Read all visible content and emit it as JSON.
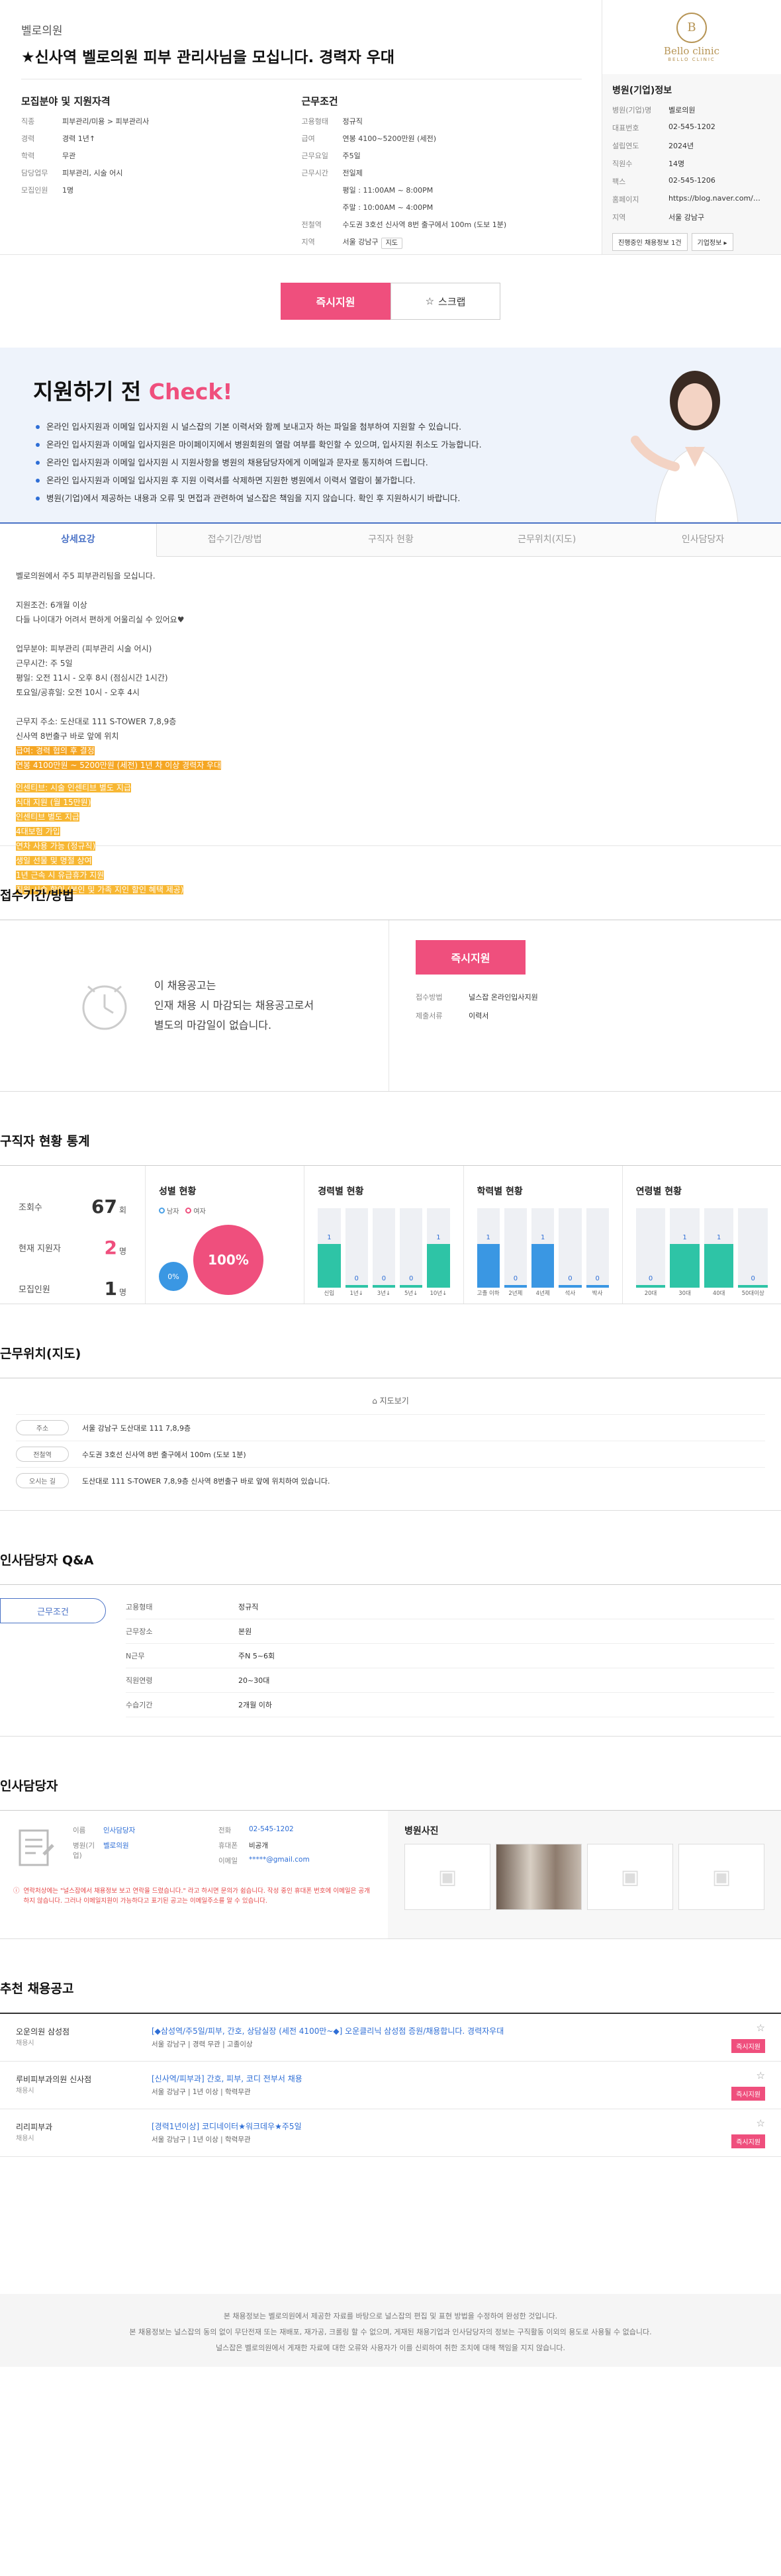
{
  "company_name": "벨로의원",
  "job_title": "★신사역 벨로의원 피부 관리사님을 모십니다. 경력자 우대",
  "recruit": {
    "heading": "모집분야 및 지원자격",
    "rows": [
      {
        "k": "직종",
        "v": "피부관리/미용 > 피부관리사"
      },
      {
        "k": "경력",
        "v": "경력 1년↑"
      },
      {
        "k": "학력",
        "v": "무관"
      },
      {
        "k": "담당업무",
        "v": "피부관리, 시술 어시"
      },
      {
        "k": "모집인원",
        "v": "1명"
      }
    ]
  },
  "work": {
    "heading": "근무조건",
    "rows": [
      {
        "k": "고용형태",
        "v": "정규직"
      },
      {
        "k": "급여",
        "v": "연봉 4100~5200만원 (세전)"
      },
      {
        "k": "근무요일",
        "v": "주5일"
      },
      {
        "k": "근무시간",
        "v": "전일제"
      },
      {
        "k": "",
        "v": "평일 : 11:00AM ~ 8:00PM"
      },
      {
        "k": "",
        "v": "주말 : 10:00AM ~ 4:00PM"
      },
      {
        "k": "전철역",
        "v": "수도권 3호선 신사역 8번 출구에서 100m (도보 1분)"
      },
      {
        "k": "지역",
        "v": "서울 강남구"
      }
    ],
    "map_btn": "지도"
  },
  "company_info": {
    "logo_text": "Bello clinic",
    "logo_sub": "BELLO CLINIC",
    "heading": "병원(기업)정보",
    "rows": [
      {
        "k": "병원(기업)명",
        "v": "벨로의원"
      },
      {
        "k": "대표번호",
        "v": "02-545-1202"
      },
      {
        "k": "설립연도",
        "v": "2024년"
      },
      {
        "k": "직원수",
        "v": "14명"
      },
      {
        "k": "팩스",
        "v": "02-545-1206"
      },
      {
        "k": "홈페이지",
        "v": "https://blog.naver.com/bello..."
      },
      {
        "k": "지역",
        "v": "서울 강남구"
      }
    ],
    "btn_jobs": "진행중인 채용정보 1건",
    "btn_info": "기업정보 ▸"
  },
  "apply_btn": "즉시지원",
  "scrap_btn": "스크랩",
  "check": {
    "title_a": "지원하기 전 ",
    "title_b": "Check!",
    "items": [
      "온라인 입사지원과 이메일 입사지원 시 널스잡의 기본 이력서와 함께 보내고자 하는 파일을 첨부하여 지원할 수 있습니다.",
      "온라인 입사지원과 이메일 입사지원은 마이페이지에서 병원회원의 열람 여부를 확인할 수 있으며, 입사지원 취소도 가능합니다.",
      "온라인 입사지원과 이메일 입사지원 시 지원사항을 병원의 채용담당자에게 이메일과 문자로 통지하여 드립니다.",
      "온라인 입사지원과 이메일 입사지원 후 지원 이력서를 삭제하면 지원한 병원에서 이력서 열람이 불가합니다.",
      "병원(기업)에서 제공하는 내용과 오류 및 면접과 관련하여 널스잡은 책임을 지지 않습니다. 확인 후 지원하시기 바랍니다."
    ]
  },
  "tabs": [
    "상세요강",
    "접수기간/방법",
    "구직자 현황",
    "근무위치(지도)",
    "인사담당자"
  ],
  "detail": {
    "plain": [
      "벨로의원에서 주5 피부관리팀을 모십니다.",
      "",
      "지원조건: 6개월 이상",
      "다들 나이대가 어려서 편하게 어울리실 수 있어요♥",
      "",
      "업무분야: 피부관리 (피부관리 시술 어시)",
      "근무시간: 주 5일",
      "평일: 오전 11시 - 오후 8시 (점심시간 1시간)",
      "토요일/공휴일: 오전 10시 - 오후 4시",
      "",
      "근무지 주소: 도산대로 111 S-TOWER 7,8,9층",
      "신사역 8번출구 바로 앞에 위치"
    ],
    "hl1": [
      "급여: 경력 협의 후 결정",
      "연봉 4100만원 ~ 5200만원 (세전) 1년 차 이상 경력자 우대"
    ],
    "hl2": [
      "인센티브: 시술 인센티브 별도 지급",
      "식대 지원 (월 15만원)",
      "인센티브 별도 지급",
      "4대보험 가입",
      "연차 사용 가능 (정규직)",
      "생일 선물 및 명절 상여",
      "1년 근속 시 유급휴가 지원",
      "직원 시술 할인 (본인 및 가족 지인 할인 혜택 제공)"
    ]
  },
  "recv": {
    "heading": "접수기간/방법",
    "text1": "이 채용공고는",
    "text2": "인재 채용 시 마감되는 채용공고로서",
    "text3": "별도의 마감일이 없습니다.",
    "rows": [
      {
        "k": "접수방법",
        "v": "널스잡 온라인입사지원"
      },
      {
        "k": "제출서류",
        "v": "이력서"
      }
    ]
  },
  "stats": {
    "heading": "구직자 현황 통계",
    "views_k": "조회수",
    "views_v": "67",
    "views_u": "회",
    "apps_k": "현재 지원자",
    "apps_v": "2",
    "apps_u": "명",
    "recruit_k": "모집인원",
    "recruit_v": "1",
    "recruit_u": "명",
    "gender_title": "성별 현황",
    "male": "남자",
    "female": "여자",
    "male_pct": "0%",
    "female_pct": "100%",
    "career_title": "경력별 현황",
    "edu_title": "학력별 현황",
    "age_title": "연령별 현황"
  },
  "chart_data": [
    {
      "type": "bar",
      "title": "경력별 현황",
      "categories": [
        "신입",
        "1년↓",
        "3년↓",
        "5년↓",
        "10년↓"
      ],
      "values": [
        1,
        0,
        0,
        0,
        1
      ]
    },
    {
      "type": "bar",
      "title": "학력별 현황",
      "categories": [
        "고졸 이하",
        "2년제",
        "4년제",
        "석사",
        "박사"
      ],
      "values": [
        1,
        0,
        1,
        0,
        0
      ]
    },
    {
      "type": "bar",
      "title": "연령별 현황",
      "categories": [
        "20대",
        "30대",
        "40대",
        "50대이상"
      ],
      "values": [
        0,
        1,
        1,
        0
      ]
    }
  ],
  "map": {
    "heading": "근무위치(지도)",
    "link": "지도보기",
    "rows": [
      {
        "k": "주소",
        "v": "서울 강남구 도산대로 111 7,8,9층"
      },
      {
        "k": "전철역",
        "v": "수도권 3호선 신사역 8번 출구에서 100m (도보 1분)"
      },
      {
        "k": "오시는 길",
        "v": "도산대로 111 S-TOWER 7,8,9층 신사역 8번출구 바로 앞에 위치하여 있습니다."
      }
    ]
  },
  "qa": {
    "heading": "인사담당자 Q&A",
    "tab": "근무조건",
    "rows": [
      {
        "k": "고용형태",
        "v": "정규직"
      },
      {
        "k": "근무장소",
        "v": "본원"
      },
      {
        "k": "N근무",
        "v": "주N 5~6회"
      },
      {
        "k": "직원연령",
        "v": "20~30대"
      },
      {
        "k": "수습기간",
        "v": "2개월 이하"
      }
    ]
  },
  "contact": {
    "heading": "인사담당자",
    "rows_l": [
      {
        "k": "이름",
        "v": "인사담당자"
      },
      {
        "k": "병원(기업)",
        "v": "벨로의원"
      }
    ],
    "rows_r": [
      {
        "k": "전화",
        "v": "02-545-1202"
      },
      {
        "k": "휴대폰",
        "v": "비공개"
      },
      {
        "k": "이메일",
        "v": "*****@gmail.com"
      }
    ],
    "warn": "연락처상에는 \"널스잡에서 채용정보 보고 연락을 드렸습니다.\" 라고 하시면 문의가 쉽습니다. 작성 중인 휴대폰 번호에 이메일은 공개하지 않습니다. 그러나 이메일지원이 가능하다고 표기된 공고는 이메일주소를 알 수 있습니다.",
    "photos_title": "병원사진"
  },
  "rec": {
    "heading": "추천 채용공고",
    "items": [
      {
        "co": "오운의원 삼성점",
        "sub": "채용시",
        "title": "[◆삼성역/주5일/피부, 간호, 상담실장 (세전 4100만~◆] 오운클리닉 삼성점 증원/채용합니다. 경력자우대",
        "meta": "서울 강남구  |  경력 무관  |  고졸이상"
      },
      {
        "co": "루비피부과의원 신사점",
        "sub": "채용시",
        "title": "[신사역/피부과] 간호, 피부, 코디 전부서 채용",
        "meta": "서울 강남구  |  1년 이상  |  학력무관"
      },
      {
        "co": "리리피부과",
        "sub": "채용시",
        "title": "[경력1년이상] 코디네이터★워크데우★주5일",
        "meta": "서울 강남구  |  1년 이상  |  학력무관"
      }
    ],
    "btn": "즉시지원"
  },
  "footer": {
    "l1": "본 채용정보는 벨로의원에서 제공한 자료를 바탕으로 널스잡의 편집 및 표현 방법을 수정하여 완성한 것입니다.",
    "l2": "본 채용정보는 널스잡의 동의 없이 무단전재 또는 재배포, 재가공, 크롤링 할 수 없으며, 게재된 채용기업과 인사담당자의 정보는 구직활동 이외의 용도로 사용될 수 없습니다.",
    "l3": "널스잡은 벨로의원에서 게재한 자료에 대한 오류와 사용자가 이를 신뢰하여 취한 조치에 대해 책임을 지지 않습니다."
  }
}
